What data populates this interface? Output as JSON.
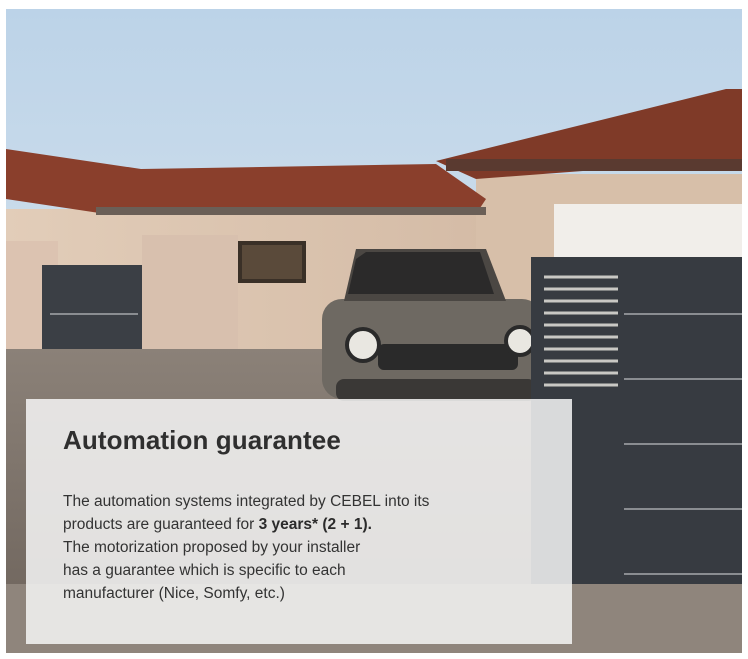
{
  "section": {
    "title": "Automation guarantee",
    "line1": "The automation systems integrated by CEBEL into its",
    "line2_prefix": "products are guaranteed for ",
    "line2_bold": "3 years* (2 + 1).",
    "line3": "The motorization proposed by your installer",
    "line4": "has a guarantee which is specific to each",
    "line5": "manufacturer (Nice, Somfy, etc.)"
  },
  "colors": {
    "sky": "#cfe0ee",
    "roof": "#8a3f2c",
    "wall": "#d9c3b0",
    "gate": "#3a3e44",
    "overlay": "#f4f4f4",
    "text": "#333333"
  }
}
